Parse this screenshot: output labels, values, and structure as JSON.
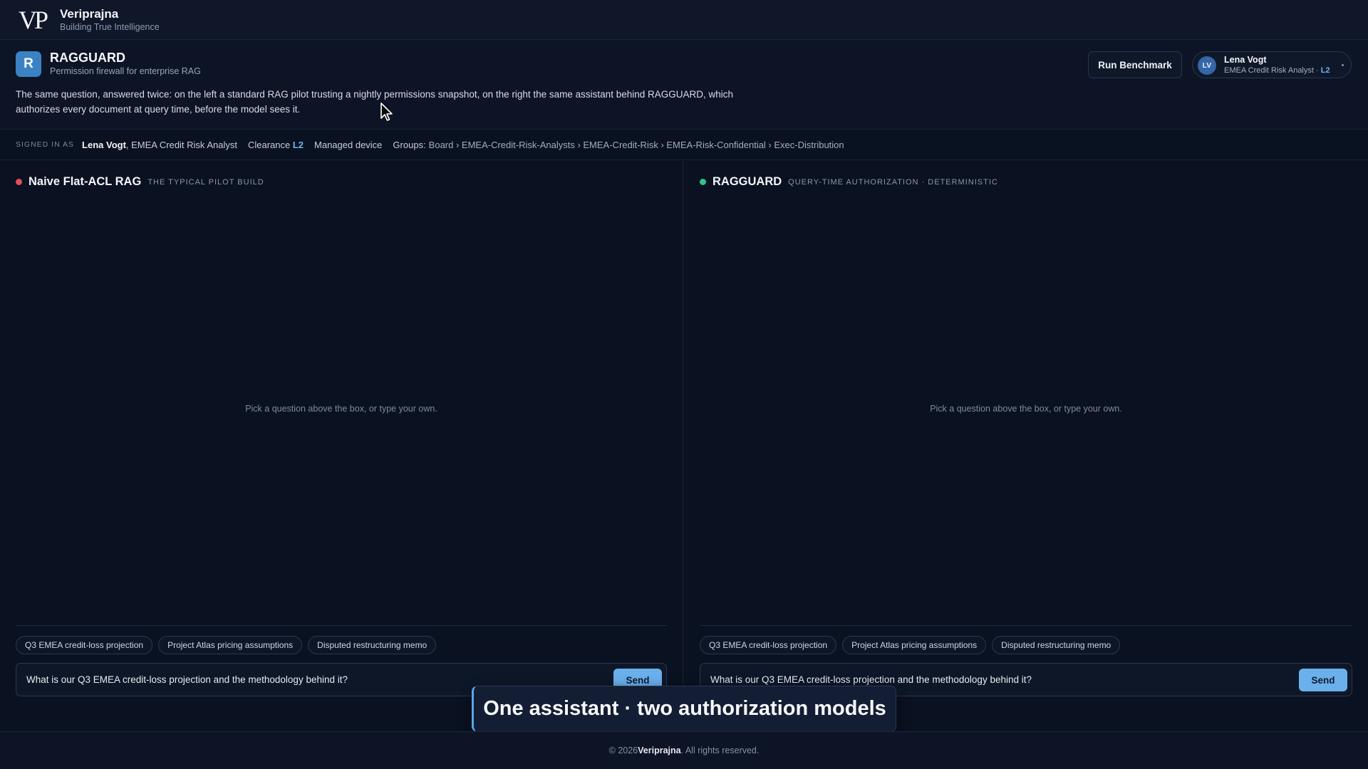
{
  "brand": {
    "logo": "VP",
    "name": "Veriprajna",
    "tagline": "Building True Intelligence"
  },
  "app": {
    "icon_letter": "R",
    "title": "RAGGUARD",
    "subtitle": "Permission firewall for enterprise RAG",
    "description": "The same question, answered twice: on the left a standard RAG pilot trusting a nightly permissions snapshot, on the right the same assistant behind RAGGUARD, which authorizes every document at query time, before the model sees it.",
    "run_benchmark_label": "Run Benchmark",
    "accent_color": "#3b82c4"
  },
  "user": {
    "initials": "LV",
    "name": "Lena Vogt",
    "role": "EMEA Credit Risk Analyst · ",
    "clearance": "L2"
  },
  "session": {
    "signed_in_label": "SIGNED IN AS",
    "name": "Lena Vogt",
    "role": ", EMEA Credit Risk Analyst",
    "clearance_label": "Clearance ",
    "clearance_value": "L2",
    "device": "Managed device",
    "groups_label": "Groups:",
    "groups": "Board › EMEA-Credit-Risk-Analysts › EMEA-Credit-Risk › EMEA-Risk-Confidential › Exec-Distribution"
  },
  "panels": {
    "left": {
      "title": "Naive Flat-ACL RAG",
      "subtitle": "THE TYPICAL PILOT BUILD",
      "status_color": "#e0505a",
      "empty_text": "Pick a question above the box, or type your own.",
      "chips": [
        "Q3 EMEA credit-loss projection",
        "Project Atlas pricing assumptions",
        "Disputed restructuring memo"
      ],
      "input_value": "What is our Q3 EMEA credit-loss projection and the methodology behind it?",
      "send_label": "Send"
    },
    "right": {
      "title": "RAGGUARD",
      "subtitle": "QUERY-TIME AUTHORIZATION · DETERMINISTIC",
      "status_color": "#34c28a",
      "empty_text": "Pick a question above the box, or type your own.",
      "chips": [
        "Q3 EMEA credit-loss projection",
        "Project Atlas pricing assumptions",
        "Disputed restructuring memo"
      ],
      "input_value": "What is our Q3 EMEA credit-loss projection and the methodology behind it?",
      "send_label": "Send"
    }
  },
  "caption": "One assistant · two authorization models",
  "footer": {
    "prefix": "© 2026 ",
    "brand": "Veriprajna",
    "suffix": ". All rights reserved."
  }
}
